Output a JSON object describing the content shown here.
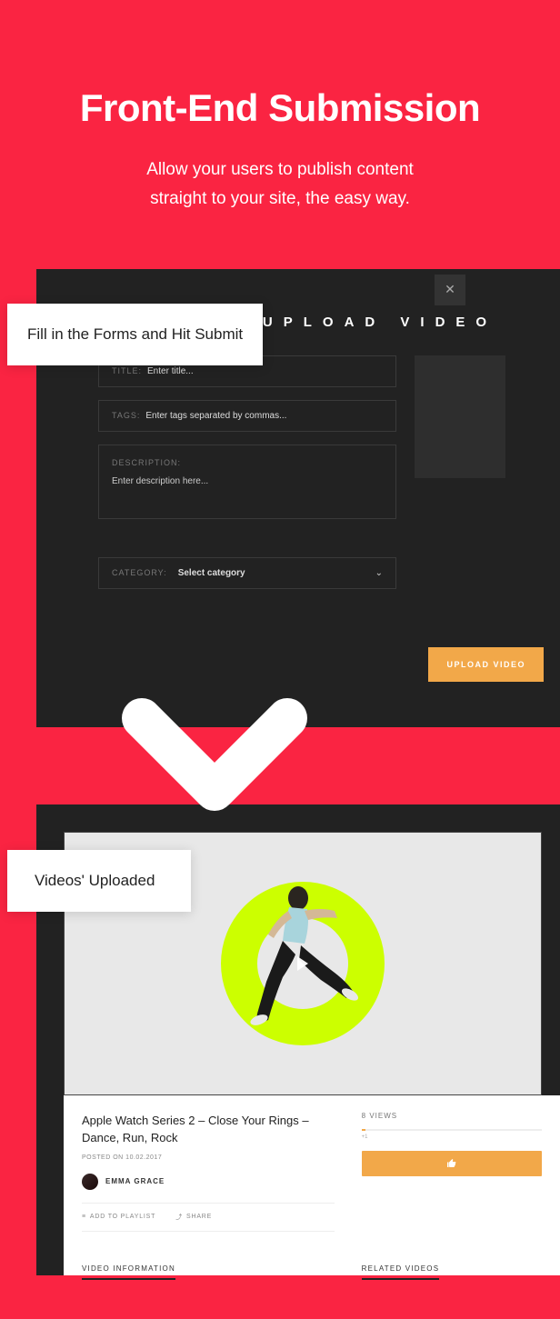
{
  "hero": {
    "title": "Front-End Submission",
    "subtitle_line1": "Allow your users to publish content",
    "subtitle_line2": "straight to your site, the easy way."
  },
  "label1": "Fill in the Forms and Hit Submit",
  "label2": "Videos' Uploaded",
  "upload_panel": {
    "title": "UPLOAD VIDEO",
    "close": "✕",
    "fields": {
      "title_label": "TITLE:",
      "title_placeholder": "Enter title...",
      "tags_label": "TAGS:",
      "tags_placeholder": "Enter tags separated by commas...",
      "desc_label": "DESCRIPTION:",
      "desc_placeholder": "Enter description here...",
      "cat_label": "CATEGORY:",
      "cat_value": "Select category"
    },
    "button": "UPLOAD VIDEO"
  },
  "video": {
    "title": "Apple Watch Series 2 – Close Your Rings – Dance, Run, Rock",
    "posted": "POSTED ON 10.02.2017",
    "author": "EMMA GRACE",
    "add_playlist": "ADD TO PLAYLIST",
    "share": "SHARE",
    "views": "8 VIEWS",
    "bar_label": "+1",
    "info_label": "VIDEO INFORMATION",
    "related_label": "RELATED VIDEOS"
  }
}
